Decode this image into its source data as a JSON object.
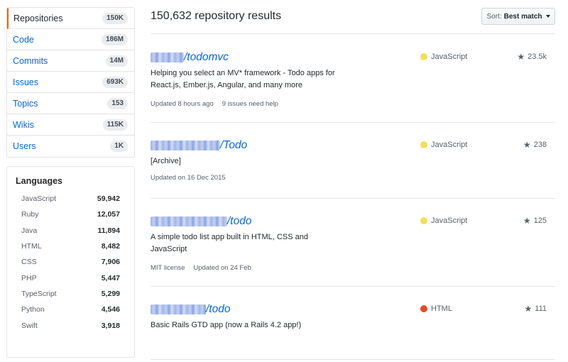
{
  "filters": [
    {
      "label": "Repositories",
      "count": "150K",
      "selected": true
    },
    {
      "label": "Code",
      "count": "186M"
    },
    {
      "label": "Commits",
      "count": "14M"
    },
    {
      "label": "Issues",
      "count": "693K"
    },
    {
      "label": "Topics",
      "count": "153"
    },
    {
      "label": "Wikis",
      "count": "115K"
    },
    {
      "label": "Users",
      "count": "1K"
    }
  ],
  "languages": {
    "title": "Languages",
    "items": [
      {
        "name": "JavaScript",
        "count": "59,942"
      },
      {
        "name": "Ruby",
        "count": "12,057"
      },
      {
        "name": "Java",
        "count": "11,894"
      },
      {
        "name": "HTML",
        "count": "8,482"
      },
      {
        "name": "CSS",
        "count": "7,906"
      },
      {
        "name": "PHP",
        "count": "5,447"
      },
      {
        "name": "TypeScript",
        "count": "5,299"
      },
      {
        "name": "Python",
        "count": "4,546"
      },
      {
        "name": "Swift",
        "count": "3,918"
      }
    ]
  },
  "results": {
    "heading": "150,632 repository results",
    "sort_prefix": "Sort:",
    "sort_value": "Best match"
  },
  "repos": [
    {
      "name": "/todomvc",
      "description": "Helping you select an MV* framework - Todo apps for React.js, Ember.js, Angular, and many more",
      "meta": [
        "Updated 8 hours ago",
        "9 issues need help"
      ],
      "language": "JavaScript",
      "language_color": "#f1e05a",
      "stars": "23.5k"
    },
    {
      "name": "/Todo",
      "description": "[Archive]",
      "meta": [
        "Updated on 16 Dec 2015"
      ],
      "language": "JavaScript",
      "language_color": "#f1e05a",
      "stars": "238"
    },
    {
      "name": "/todo",
      "description": "A simple todo list app built in HTML, CSS and JavaScript",
      "meta": [
        "MIT license",
        "Updated on 24 Feb"
      ],
      "language": "JavaScript",
      "language_color": "#f1e05a",
      "stars": "125"
    },
    {
      "name": "/todo",
      "description": "Basic Rails GTD app (now a Rails 4.2 app!)",
      "meta": [],
      "language": "HTML",
      "language_color": "#e34c26",
      "stars": "111"
    }
  ],
  "icons": {
    "star": "star-icon",
    "caret": "caret-down-icon"
  }
}
